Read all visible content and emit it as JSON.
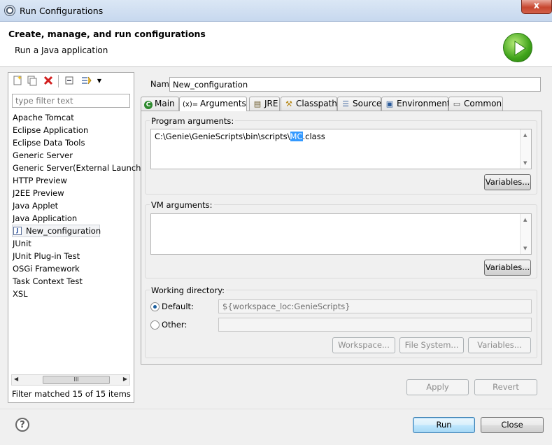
{
  "window": {
    "title": "Run Configurations",
    "close_glyph": "x"
  },
  "header": {
    "title": "Create, manage, and run configurations",
    "subtitle": "Run a Java application"
  },
  "filter": {
    "placeholder": "type filter text",
    "value": ""
  },
  "config_list": [
    "Apache Tomcat",
    "Eclipse Application",
    "Eclipse Data Tools",
    "Generic Server",
    "Generic Server(External Launch)",
    "HTTP Preview",
    "J2EE Preview",
    "Java Applet",
    "Java Application",
    "New_configuration",
    "JUnit",
    "JUnit Plug-in Test",
    "OSGi Framework",
    "Task Context Test",
    "XSL"
  ],
  "selected_config": "New_configuration",
  "hscroll_thumb": "III",
  "filter_status": "Filter matched 15 of 15 items",
  "name": {
    "label": "Name:",
    "value": "New_configuration"
  },
  "tabs": [
    {
      "label": "Main",
      "icon": "C"
    },
    {
      "label": "Arguments",
      "icon": "(x)="
    },
    {
      "label": "JRE",
      "icon": "▤"
    },
    {
      "label": "Classpath",
      "icon": "⚒"
    },
    {
      "label": "Source",
      "icon": "☰"
    },
    {
      "label": "Environment",
      "icon": "▣"
    },
    {
      "label": "Common",
      "icon": "▭"
    }
  ],
  "active_tab": "Arguments",
  "program_args": {
    "label": "Program arguments:",
    "text_before": "C:\\Genie\\GenieScripts\\bin\\scripts\\",
    "text_selected": "MC",
    "text_after": ".class",
    "variables_label": "Variables..."
  },
  "vm_args": {
    "label": "VM arguments:",
    "value": "",
    "variables_label": "Variables..."
  },
  "working_dir": {
    "label": "Working directory:",
    "default_label": "Default:",
    "default_value": "${workspace_loc:GenieScripts}",
    "other_label": "Other:",
    "other_value": "",
    "workspace_label": "Workspace...",
    "filesystem_label": "File System...",
    "variables_label": "Variables..."
  },
  "actions": {
    "apply": "Apply",
    "revert": "Revert",
    "run": "Run",
    "close": "Close"
  },
  "help_glyph": "?"
}
